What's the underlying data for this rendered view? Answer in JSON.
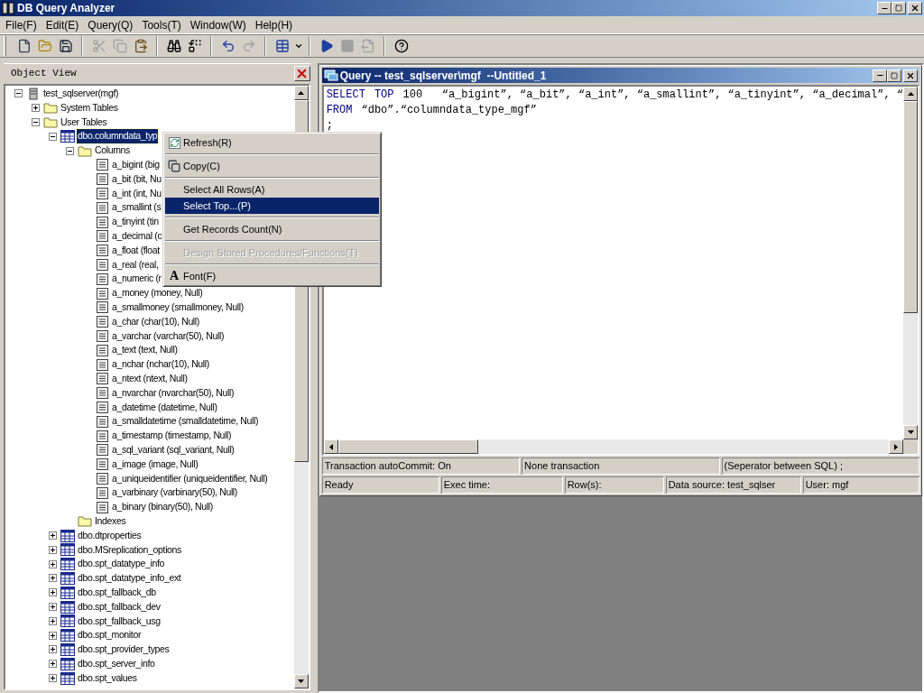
{
  "window": {
    "title": "DB Query Analyzer"
  },
  "menu_bar": [
    "File(F)",
    "Edit(E)",
    "Query(Q)",
    "Tools(T)",
    "Window(W)",
    "Help(H)"
  ],
  "toolbar": [
    {
      "kind": "new",
      "disabled": false
    },
    {
      "kind": "open",
      "disabled": false
    },
    {
      "kind": "save",
      "disabled": false
    },
    {
      "kind": "sep"
    },
    {
      "kind": "cut",
      "disabled": true
    },
    {
      "kind": "copy",
      "disabled": true
    },
    {
      "kind": "paste",
      "disabled": false
    },
    {
      "kind": "sep"
    },
    {
      "kind": "find",
      "disabled": false
    },
    {
      "kind": "replace",
      "disabled": false
    },
    {
      "kind": "sep"
    },
    {
      "kind": "undo",
      "disabled": false
    },
    {
      "kind": "redo",
      "disabled": true
    },
    {
      "kind": "sep"
    },
    {
      "kind": "grid",
      "disabled": false
    },
    {
      "kind": "sep"
    },
    {
      "kind": "run",
      "disabled": false
    },
    {
      "kind": "stop",
      "disabled": true
    },
    {
      "kind": "export",
      "disabled": true
    },
    {
      "kind": "sep"
    },
    {
      "kind": "help",
      "disabled": false
    }
  ],
  "object_view": {
    "title": "Object View",
    "tree": [
      {
        "label": "test_sqlserver(mgf)",
        "kind": "server",
        "expanded": true,
        "selected": false,
        "children": [
          {
            "label": "System Tables",
            "kind": "folder",
            "expanded": false,
            "selected": false
          },
          {
            "label": "User Tables",
            "kind": "folder",
            "expanded": true,
            "selected": false,
            "children": [
              {
                "label": "dbo.columndata_typ",
                "kind": "table",
                "expanded": true,
                "selected": true,
                "children": [
                  {
                    "label": "Columns",
                    "kind": "folder",
                    "expanded": true,
                    "selected": false,
                    "children": [
                      {
                        "label": "a_bigint (big",
                        "kind": "column",
                        "selected": false
                      },
                      {
                        "label": "a_bit (bit, Nu",
                        "kind": "column",
                        "selected": false
                      },
                      {
                        "label": "a_int (int, Nu",
                        "kind": "column",
                        "selected": false
                      },
                      {
                        "label": "a_smallint (s",
                        "kind": "column",
                        "selected": false
                      },
                      {
                        "label": "a_tinyint (tin",
                        "kind": "column",
                        "selected": false
                      },
                      {
                        "label": "a_decimal (c",
                        "kind": "column",
                        "selected": false
                      },
                      {
                        "label": "a_float (float",
                        "kind": "column",
                        "selected": false
                      },
                      {
                        "label": "a_real (real,",
                        "kind": "column",
                        "selected": false
                      },
                      {
                        "label": "a_numeric (r",
                        "kind": "column",
                        "selected": false
                      },
                      {
                        "label": "a_money (money, Null)",
                        "kind": "column",
                        "selected": false
                      },
                      {
                        "label": "a_smallmoney (smallmoney, Null)",
                        "kind": "column",
                        "selected": false
                      },
                      {
                        "label": "a_char (char(10), Null)",
                        "kind": "column",
                        "selected": false
                      },
                      {
                        "label": "a_varchar (varchar(50), Null)",
                        "kind": "column",
                        "selected": false
                      },
                      {
                        "label": "a_text (text, Null)",
                        "kind": "column",
                        "selected": false
                      },
                      {
                        "label": "a_nchar (nchar(10), Null)",
                        "kind": "column",
                        "selected": false
                      },
                      {
                        "label": "a_ntext (ntext, Null)",
                        "kind": "column",
                        "selected": false
                      },
                      {
                        "label": "a_nvarchar (nvarchar(50), Null)",
                        "kind": "column",
                        "selected": false
                      },
                      {
                        "label": "a_datetime (datetime, Null)",
                        "kind": "column",
                        "selected": false
                      },
                      {
                        "label": "a_smalldatetime (smalldatetime, Null)",
                        "kind": "column",
                        "selected": false
                      },
                      {
                        "label": "a_timestamp (timestamp, Null)",
                        "kind": "column",
                        "selected": false
                      },
                      {
                        "label": "a_sql_variant (sql_variant, Null)",
                        "kind": "column",
                        "selected": false
                      },
                      {
                        "label": "a_image (image, Null)",
                        "kind": "column",
                        "selected": false
                      },
                      {
                        "label": "a_uniqueidentifier (uniqueidentifier, Null)",
                        "kind": "column",
                        "selected": false
                      },
                      {
                        "label": "a_varbinary (varbinary(50), Null)",
                        "kind": "column",
                        "selected": false
                      },
                      {
                        "label": "a_binary (binary(50), Null)",
                        "kind": "column",
                        "selected": false
                      }
                    ]
                  },
                  {
                    "label": "Indexes",
                    "kind": "folder",
                    "selected": false
                  }
                ]
              },
              {
                "label": "dbo.dtproperties",
                "kind": "table",
                "expanded": false,
                "selected": false
              },
              {
                "label": "dbo.MSreplication_options",
                "kind": "table",
                "expanded": false,
                "selected": false
              },
              {
                "label": "dbo.spt_datatype_info",
                "kind": "table",
                "expanded": false,
                "selected": false
              },
              {
                "label": "dbo.spt_datatype_info_ext",
                "kind": "table",
                "expanded": false,
                "selected": false
              },
              {
                "label": "dbo.spt_fallback_db",
                "kind": "table",
                "expanded": false,
                "selected": false
              },
              {
                "label": "dbo.spt_fallback_dev",
                "kind": "table",
                "expanded": false,
                "selected": false
              },
              {
                "label": "dbo.spt_fallback_usg",
                "kind": "table",
                "expanded": false,
                "selected": false
              },
              {
                "label": "dbo.spt_monitor",
                "kind": "table",
                "expanded": false,
                "selected": false
              },
              {
                "label": "dbo.spt_provider_types",
                "kind": "table",
                "expanded": false,
                "selected": false
              },
              {
                "label": "dbo.spt_server_info",
                "kind": "table",
                "expanded": false,
                "selected": false
              },
              {
                "label": "dbo.spt_values",
                "kind": "table",
                "expanded": false,
                "selected": false
              }
            ]
          }
        ]
      }
    ]
  },
  "context_menu": {
    "groups": [
      [
        {
          "label": "Refresh(R)",
          "kind": "refresh",
          "disabled": false,
          "selected": false
        }
      ],
      [
        {
          "label": "Copy(C)",
          "kind": "copy",
          "disabled": false,
          "selected": false
        }
      ],
      [
        {
          "label": "Select All Rows(A)",
          "kind": "plain",
          "disabled": false,
          "selected": false
        },
        {
          "label": "Select Top...(P)",
          "kind": "plain",
          "disabled": false,
          "selected": true
        }
      ],
      [
        {
          "label": "Get Records Count(N)",
          "kind": "plain",
          "disabled": false,
          "selected": false
        }
      ],
      [
        {
          "label": "Design Stored Procedures/Functions(T)",
          "kind": "plain",
          "disabled": true,
          "selected": false
        }
      ],
      [
        {
          "label": "Font(F)",
          "kind": "font",
          "glyph": "A",
          "disabled": false,
          "selected": false
        }
      ]
    ]
  },
  "query_window": {
    "title": "Query -- test_sqlserver\\mgf  --Untitled_1",
    "lines": [
      [
        {
          "kind": "keyword",
          "text": "SELECT"
        },
        {
          "kind": "keyword",
          "text": "TOP"
        },
        {
          "kind": "plain",
          "text": "100   “a_bigint”, “a_bit”, “a_int”, “a_smallint”, “a_tinyint”, “a_decimal”, “"
        }
      ],
      [
        {
          "kind": "keyword",
          "text": "FROM"
        },
        {
          "kind": "plain",
          "text": "“dbo”.“columndata_type_mgf”"
        }
      ],
      [
        {
          "kind": "plain",
          "text": ";"
        }
      ]
    ],
    "status_rows": [
      [
        "Transaction autoCommit: On",
        "None transaction",
        "(Seperator between SQL)  ;"
      ],
      [
        "Ready",
        "Exec time:",
        "Row(s):",
        "Data source: test_sqlser",
        "User: mgf"
      ]
    ]
  }
}
